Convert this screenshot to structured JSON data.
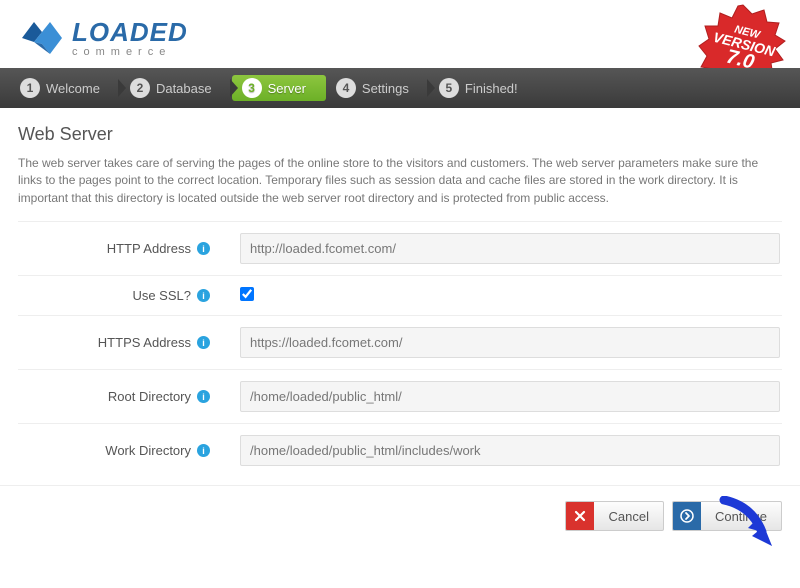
{
  "logo": {
    "main": "LOADED",
    "sub": "commerce"
  },
  "badge": {
    "line1": "NEW",
    "line2": "VERSION",
    "line3": "7.0"
  },
  "steps": [
    {
      "num": "1",
      "label": "Welcome"
    },
    {
      "num": "2",
      "label": "Database"
    },
    {
      "num": "3",
      "label": "Server"
    },
    {
      "num": "4",
      "label": "Settings"
    },
    {
      "num": "5",
      "label": "Finished!"
    }
  ],
  "page": {
    "title": "Web Server",
    "description": "The web server takes care of serving the pages of the online store to the visitors and customers. The web server parameters make sure the links to the pages point to the correct location. Temporary files such as session data and cache files are stored in the work directory. It is important that this directory is located outside the web server root directory and is protected from public access."
  },
  "fields": {
    "http_address": {
      "label": "HTTP Address",
      "value": "http://loaded.fcomet.com/"
    },
    "use_ssl": {
      "label": "Use SSL?",
      "checked": true
    },
    "https_address": {
      "label": "HTTPS Address",
      "value": "https://loaded.fcomet.com/"
    },
    "root_directory": {
      "label": "Root Directory",
      "value": "/home/loaded/public_html/"
    },
    "work_directory": {
      "label": "Work Directory",
      "value": "/home/loaded/public_html/includes/work"
    }
  },
  "buttons": {
    "cancel": "Cancel",
    "continue": "Continue"
  }
}
